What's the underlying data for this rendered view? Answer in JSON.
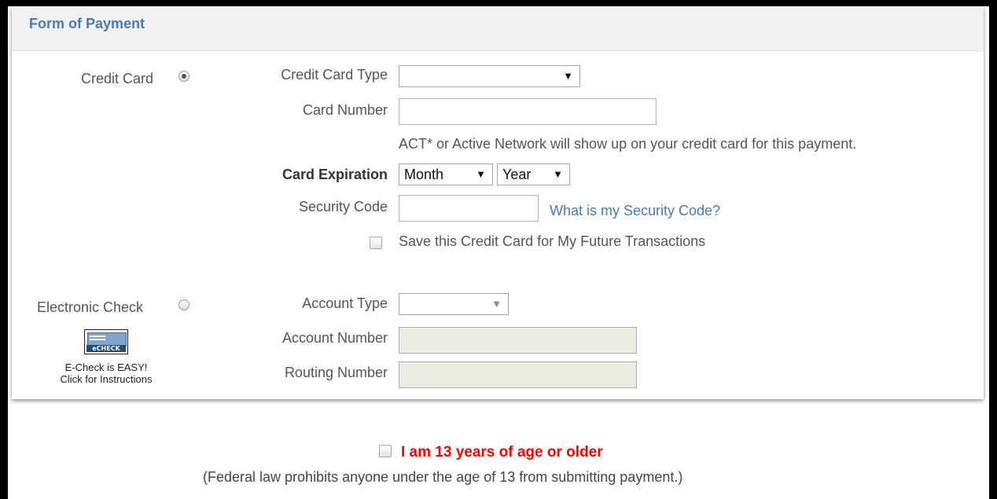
{
  "panel": {
    "title": "Form of Payment"
  },
  "credit_card": {
    "option_label": "Credit Card",
    "type_label": "Credit Card Type",
    "type_value": "",
    "number_label": "Card Number",
    "number_value": "",
    "statement_note": "ACT* or Active Network will show up on your credit card for this payment.",
    "expiration_label": "Card Expiration",
    "month_value": "Month",
    "year_value": "Year",
    "security_label": "Security Code",
    "security_value": "",
    "security_help_link": "What is my Security Code?",
    "save_label": "Save this Credit Card for My Future Transactions"
  },
  "echeck": {
    "option_label": "Electronic Check",
    "icon_text": "eCHECK",
    "caption_line1": "E-Check is EASY!",
    "caption_line2": "Click for Instructions",
    "account_type_label": "Account Type",
    "account_type_value": "",
    "account_number_label": "Account Number",
    "routing_number_label": "Routing Number"
  },
  "age": {
    "label": "I am 13 years of age or older",
    "note": "(Federal law prohibits anyone under the age of 13 from submitting payment.)"
  }
}
